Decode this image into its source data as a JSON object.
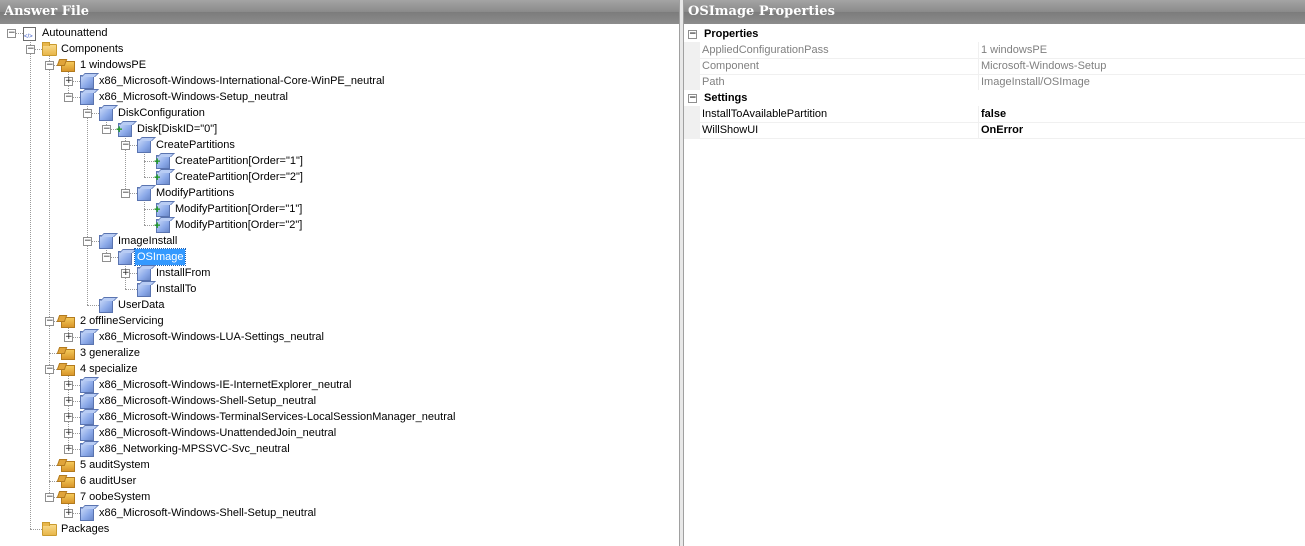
{
  "left_panel": {
    "title": "Answer File",
    "tree": [
      {
        "label": "Autounattend",
        "depth": 0,
        "icon": "document-icon",
        "expander": "minus"
      },
      {
        "label": "Components",
        "depth": 1,
        "icon": "folder-icon",
        "expander": "minus"
      },
      {
        "label": "1 windowsPE",
        "depth": 2,
        "icon": "pass-icon",
        "expander": "minus"
      },
      {
        "label": "x86_Microsoft-Windows-International-Core-WinPE_neutral",
        "depth": 3,
        "icon": "component-icon",
        "expander": "plus"
      },
      {
        "label": "x86_Microsoft-Windows-Setup_neutral",
        "depth": 3,
        "icon": "component-icon",
        "expander": "minus"
      },
      {
        "label": "DiskConfiguration",
        "depth": 4,
        "icon": "component-icon",
        "expander": "minus"
      },
      {
        "label": "Disk[DiskID=\"0\"]",
        "depth": 5,
        "icon": "list-item-icon",
        "expander": "minus"
      },
      {
        "label": "CreatePartitions",
        "depth": 6,
        "icon": "component-icon",
        "expander": "minus"
      },
      {
        "label": "CreatePartition[Order=\"1\"]",
        "depth": 7,
        "icon": "list-item-icon",
        "expander": "none"
      },
      {
        "label": "CreatePartition[Order=\"2\"]",
        "depth": 7,
        "icon": "list-item-icon",
        "expander": "none"
      },
      {
        "label": "ModifyPartitions",
        "depth": 6,
        "icon": "component-icon",
        "expander": "minus"
      },
      {
        "label": "ModifyPartition[Order=\"1\"]",
        "depth": 7,
        "icon": "list-item-icon",
        "expander": "none"
      },
      {
        "label": "ModifyPartition[Order=\"2\"]",
        "depth": 7,
        "icon": "list-item-icon",
        "expander": "none"
      },
      {
        "label": "ImageInstall",
        "depth": 4,
        "icon": "component-icon",
        "expander": "minus"
      },
      {
        "label": "OSImage",
        "depth": 5,
        "icon": "component-icon",
        "expander": "minus",
        "selected": true
      },
      {
        "label": "InstallFrom",
        "depth": 6,
        "icon": "component-icon",
        "expander": "plus"
      },
      {
        "label": "InstallTo",
        "depth": 6,
        "icon": "component-icon",
        "expander": "none"
      },
      {
        "label": "UserData",
        "depth": 4,
        "icon": "component-icon",
        "expander": "none"
      },
      {
        "label": "2 offlineServicing",
        "depth": 2,
        "icon": "pass-icon",
        "expander": "minus"
      },
      {
        "label": "x86_Microsoft-Windows-LUA-Settings_neutral",
        "depth": 3,
        "icon": "component-icon",
        "expander": "plus"
      },
      {
        "label": "3 generalize",
        "depth": 2,
        "icon": "pass-icon",
        "expander": "none"
      },
      {
        "label": "4 specialize",
        "depth": 2,
        "icon": "pass-icon",
        "expander": "minus"
      },
      {
        "label": "x86_Microsoft-Windows-IE-InternetExplorer_neutral",
        "depth": 3,
        "icon": "component-icon",
        "expander": "plus"
      },
      {
        "label": "x86_Microsoft-Windows-Shell-Setup_neutral",
        "depth": 3,
        "icon": "component-icon",
        "expander": "plus"
      },
      {
        "label": "x86_Microsoft-Windows-TerminalServices-LocalSessionManager_neutral",
        "depth": 3,
        "icon": "component-icon",
        "expander": "plus"
      },
      {
        "label": "x86_Microsoft-Windows-UnattendedJoin_neutral",
        "depth": 3,
        "icon": "component-icon",
        "expander": "plus"
      },
      {
        "label": "x86_Networking-MPSSVC-Svc_neutral",
        "depth": 3,
        "icon": "component-icon",
        "expander": "plus"
      },
      {
        "label": "5 auditSystem",
        "depth": 2,
        "icon": "pass-icon",
        "expander": "none"
      },
      {
        "label": "6 auditUser",
        "depth": 2,
        "icon": "pass-icon",
        "expander": "none"
      },
      {
        "label": "7 oobeSystem",
        "depth": 2,
        "icon": "pass-icon",
        "expander": "minus"
      },
      {
        "label": "x86_Microsoft-Windows-Shell-Setup_neutral",
        "depth": 3,
        "icon": "component-icon",
        "expander": "plus"
      },
      {
        "label": "Packages",
        "depth": 1,
        "icon": "folder-icon",
        "expander": "none"
      }
    ]
  },
  "right_panel": {
    "title": "OSImage Properties",
    "categories": [
      {
        "label": "Properties",
        "rows": [
          {
            "name": "AppliedConfigurationPass",
            "value": "1 windowsPE",
            "readonly": true
          },
          {
            "name": "Component",
            "value": "Microsoft-Windows-Setup",
            "readonly": true
          },
          {
            "name": "Path",
            "value": "ImageInstall/OSImage",
            "readonly": true
          }
        ]
      },
      {
        "label": "Settings",
        "rows": [
          {
            "name": "InstallToAvailablePartition",
            "value": "false",
            "readonly": false
          },
          {
            "name": "WillShowUI",
            "value": "OnError",
            "readonly": false
          }
        ]
      }
    ]
  },
  "colors": {
    "selection": "#3399ff",
    "title_bar": "#8a8a8a",
    "readonly_text": "#808080"
  }
}
